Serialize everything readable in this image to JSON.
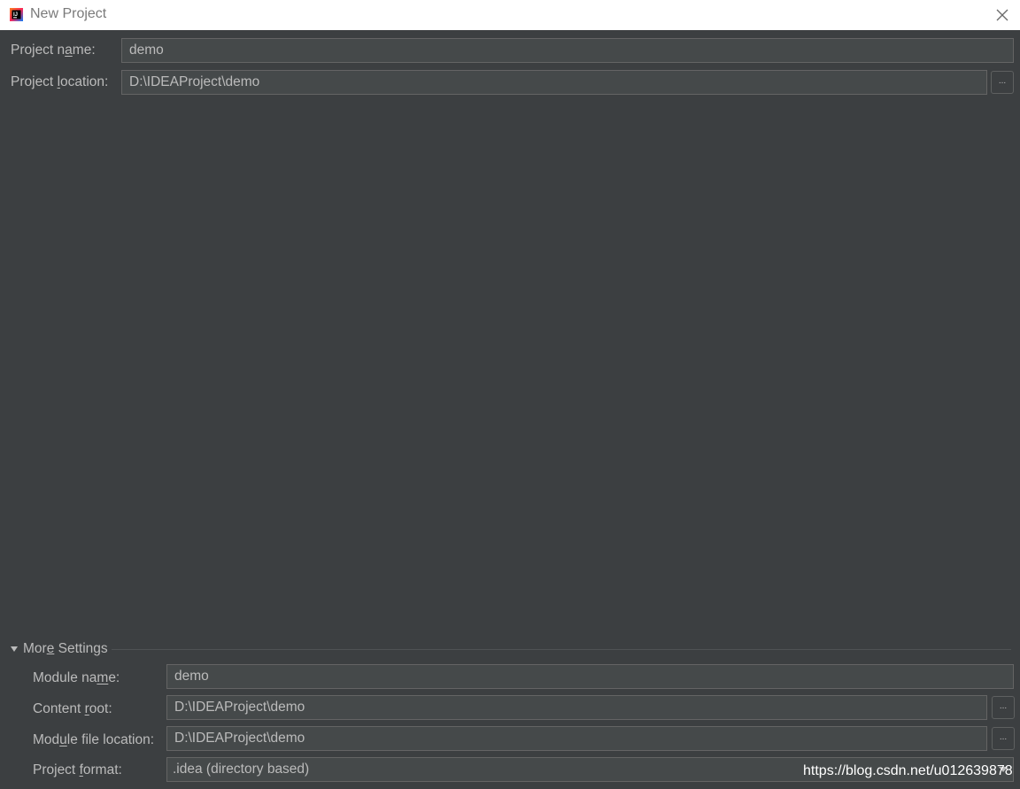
{
  "window": {
    "title": "New Project",
    "icon": "intellij-idea-icon",
    "close_icon": "close-icon"
  },
  "form": {
    "project_name": {
      "label_pre": "Project n",
      "label_mn": "a",
      "label_post": "me:",
      "value": "demo"
    },
    "project_location": {
      "label_pre": "Project ",
      "label_mn": "l",
      "label_post": "ocation:",
      "value": "D:\\IDEAProject\\demo",
      "browse_label": "..."
    }
  },
  "more_settings": {
    "label_pre": "Mor",
    "label_mn": "e",
    "label_post": " Settings",
    "expanded": true,
    "module_name": {
      "label_pre": "Module na",
      "label_mn": "m",
      "label_post": "e:",
      "value": "demo"
    },
    "content_root": {
      "label_pre": "Content ",
      "label_mn": "r",
      "label_post": "oot:",
      "value": "D:\\IDEAProject\\demo",
      "browse_label": "..."
    },
    "module_file_location": {
      "label_pre": "Mod",
      "label_mn": "u",
      "label_post": "le file location:",
      "value": "D:\\IDEAProject\\demo",
      "browse_label": "..."
    },
    "project_format": {
      "label_pre": "Project ",
      "label_mn": "f",
      "label_post": "ormat:",
      "value": ".idea (directory based)"
    }
  },
  "watermark": "https://blog.csdn.net/u012639878",
  "colors": {
    "background": "#3c3f41",
    "field_bg": "#45494a",
    "field_border": "#646464",
    "text": "#bbbbbb",
    "titlebar": "#ffffff"
  }
}
